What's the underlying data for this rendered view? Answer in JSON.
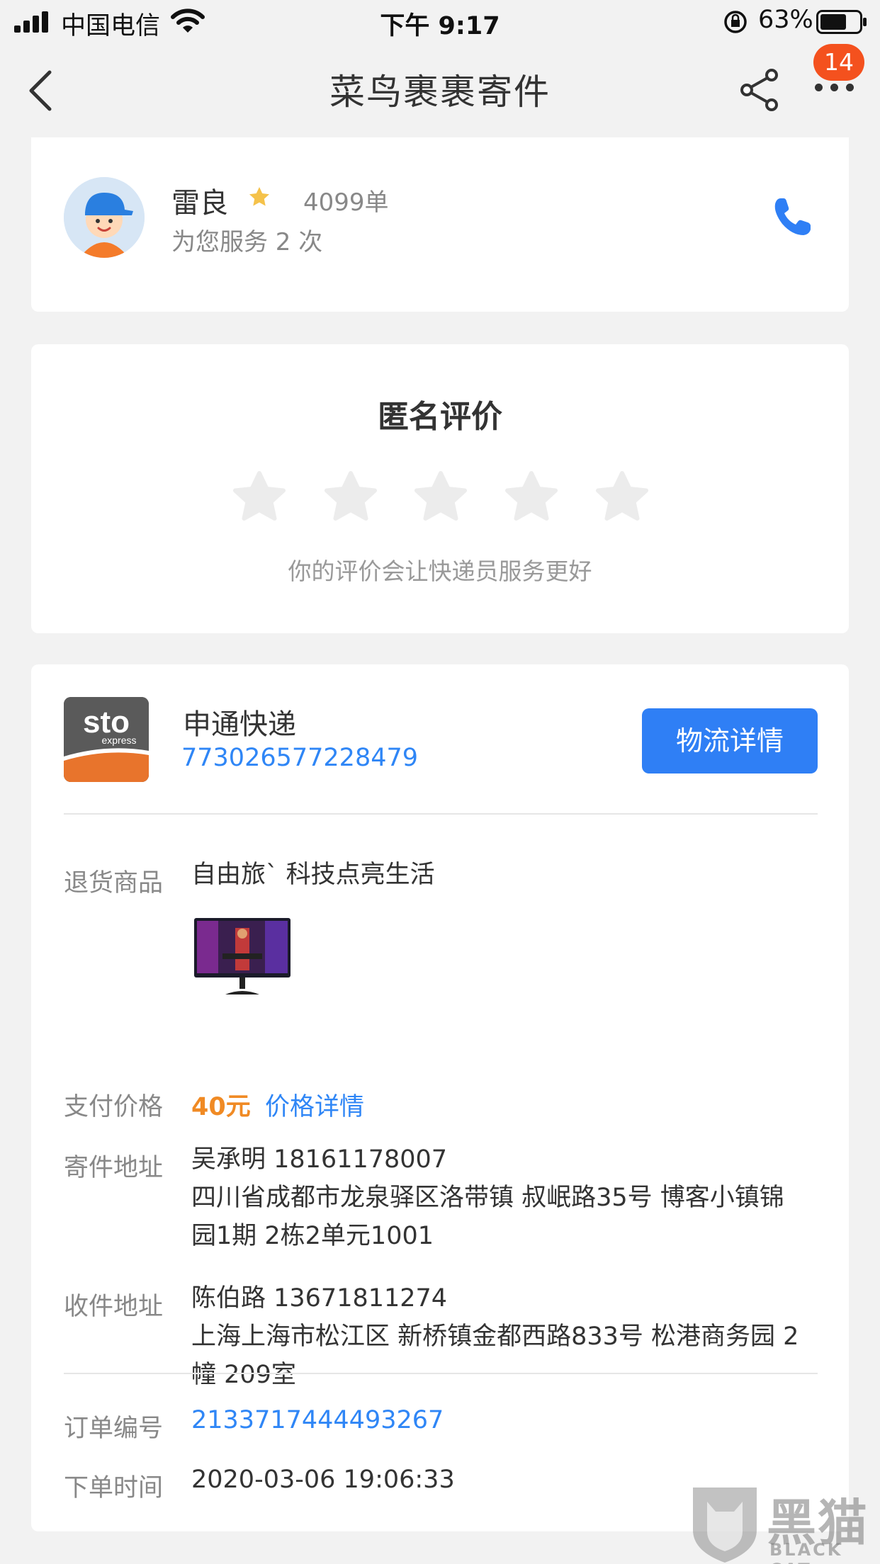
{
  "status_bar": {
    "carrier": "中国电信",
    "time": "下午 9:17",
    "battery": "63%"
  },
  "nav": {
    "title": "菜鸟裹裹寄件",
    "badge_count": "14"
  },
  "courier": {
    "name": "雷良",
    "orders": "4099单",
    "served": "为您服务 2 次"
  },
  "rating": {
    "title": "匿名评价",
    "stars_selected": 0,
    "stars_total": 5,
    "hint": "你的评价会让快递员服务更好"
  },
  "order": {
    "company": "申通快递",
    "tracking_no": "773026577228479",
    "logistics_button": "物流详情",
    "product_label": "退货商品",
    "product_name": "自由旅` 科技点亮生活",
    "price_label": "支付价格",
    "price": "40元",
    "price_detail": "价格详情",
    "sender_label": "寄件地址",
    "sender_contact": "吴承明 18161178007",
    "sender_address_1": "四川省成都市龙泉驿区洛带镇 叔岷路35号 博客小镇锦",
    "sender_address_2": "园1期 2栋2单元1001",
    "receiver_label": "收件地址",
    "receiver_contact": "陈伯路 13671811274",
    "receiver_address_1": "上海上海市松江区 新桥镇金都西路833号 松港商务园 2",
    "receiver_address_2": "幢 209室",
    "order_no_label": "订单编号",
    "order_no": "2133717444493267",
    "order_time_label": "下单时间",
    "order_time": "2020-03-06 19:06:33"
  },
  "watermark": {
    "main": "黑猫",
    "sub": "BLACK CAT"
  },
  "colors": {
    "accent_blue": "#2f7ff5",
    "price_orange": "#f08a24",
    "badge_red": "#f4511e",
    "star_gold": "#f5c24a"
  }
}
